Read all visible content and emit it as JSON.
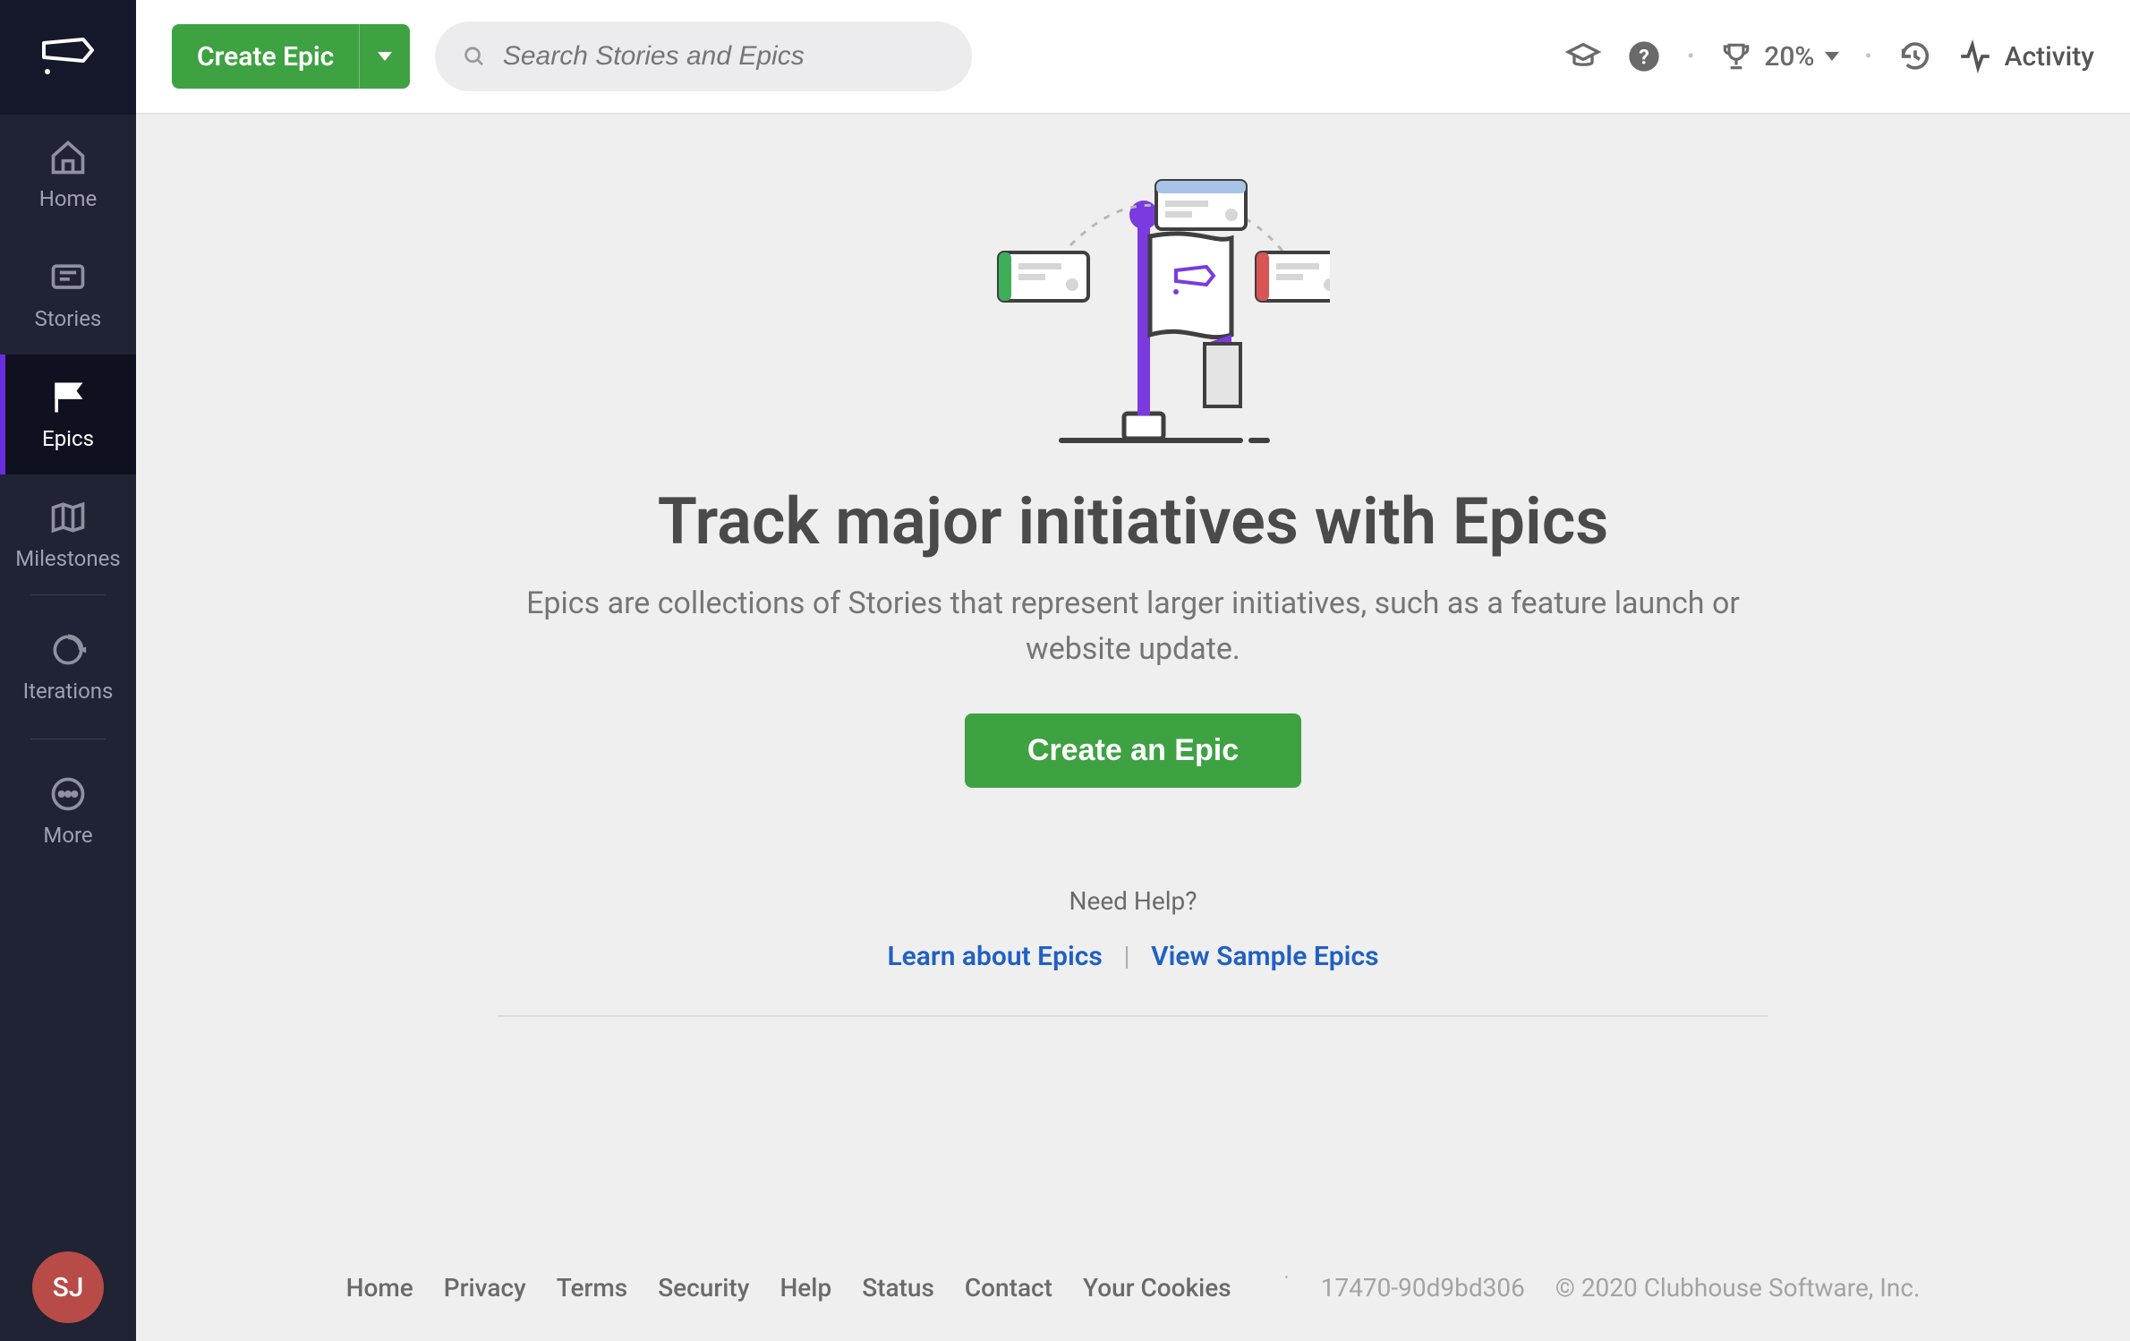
{
  "sidebar": {
    "items": [
      {
        "label": "Home"
      },
      {
        "label": "Stories"
      },
      {
        "label": "Epics"
      },
      {
        "label": "Milestones"
      },
      {
        "label": "Iterations"
      },
      {
        "label": "More"
      }
    ],
    "avatar_initials": "SJ"
  },
  "topbar": {
    "create_label": "Create Epic",
    "search_placeholder": "Search Stories and Epics",
    "progress_pct": "20%",
    "activity_label": "Activity"
  },
  "hero": {
    "title": "Track major initiatives with Epics",
    "subtitle": "Epics are collections of Stories that represent larger initiatives, such as a feature launch or website update.",
    "cta": "Create an Epic",
    "help_label": "Need Help?",
    "learn_link": "Learn about Epics",
    "sample_link": "View Sample Epics"
  },
  "footer": {
    "links": [
      "Home",
      "Privacy",
      "Terms",
      "Security",
      "Help",
      "Status",
      "Contact",
      "Your Cookies"
    ],
    "build_id": "17470-90d9bd306",
    "copyright": "© 2020 Clubhouse Software, Inc."
  }
}
